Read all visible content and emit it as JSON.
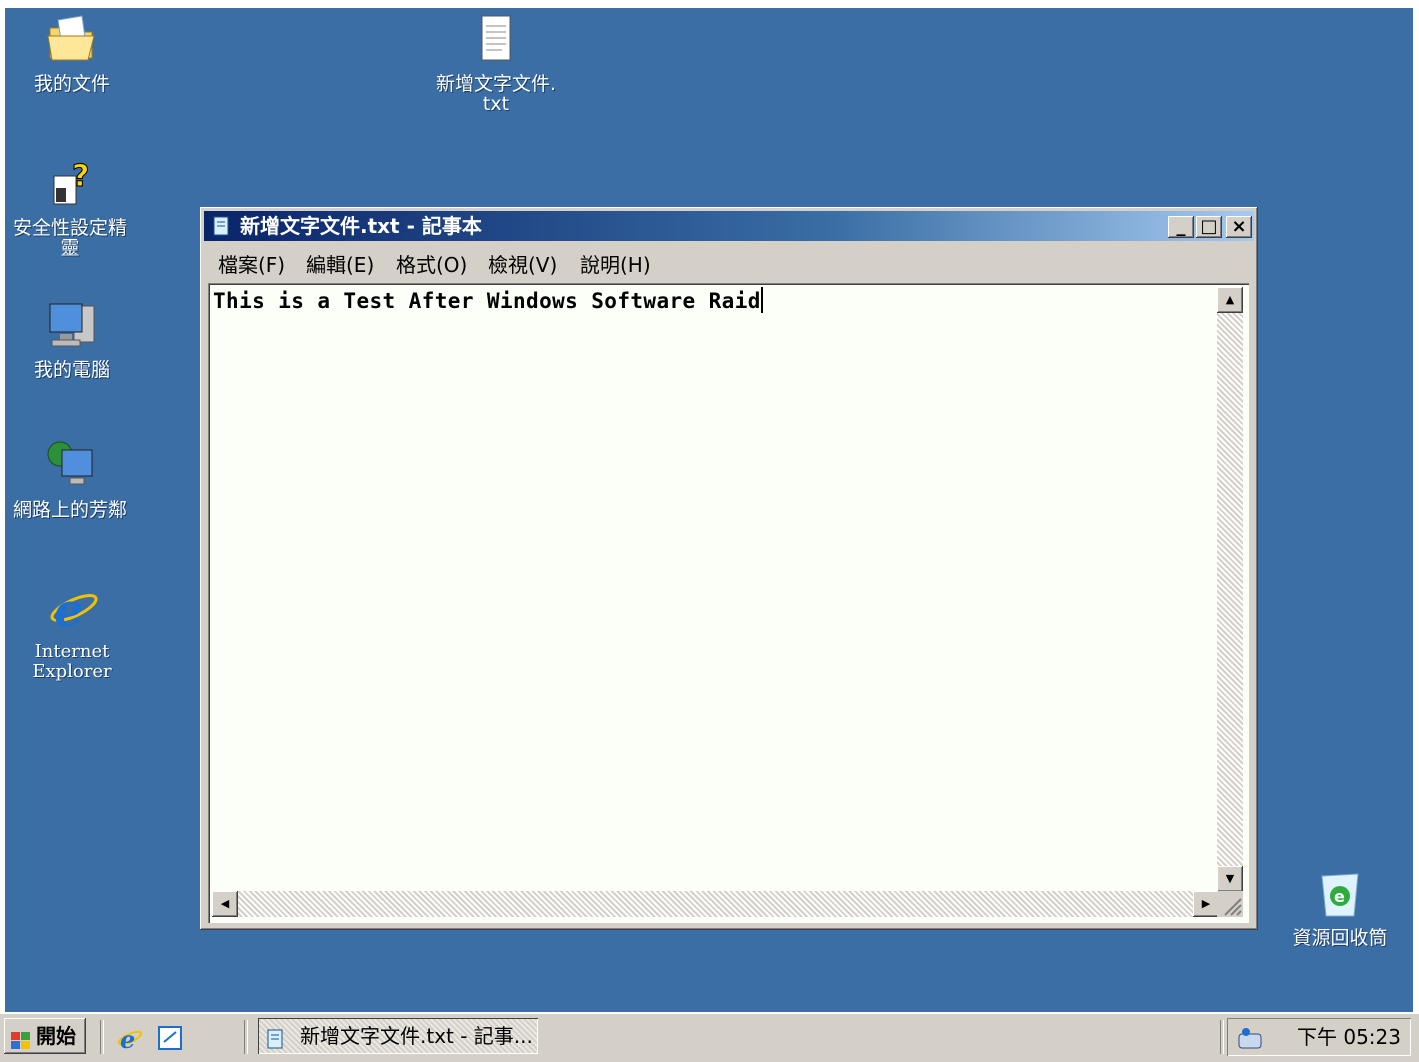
{
  "desktop": {
    "icons": [
      {
        "label": "我的文件"
      },
      {
        "label": "新增文字文件.\ntxt"
      },
      {
        "label": "安全性設定精\n靈"
      },
      {
        "label": "我的電腦"
      },
      {
        "label": "網路上的芳鄰"
      },
      {
        "label": "Internet\nExplorer"
      },
      {
        "label": "資源回收筒"
      }
    ]
  },
  "notepad": {
    "title": "新增文字文件.txt - 記事本",
    "caption_buttons": {
      "minimize": "_",
      "maximize": "□",
      "close": "×"
    },
    "menu": [
      "檔案(F)",
      "編輯(E)",
      "格式(O)",
      "檢視(V)",
      "說明(H)"
    ],
    "content": "This is a Test After Windows Software Raid"
  },
  "taskbar": {
    "start_label": "開始",
    "task_label": "新增文字文件.txt - 記事...",
    "clock": "下午 05:23"
  },
  "colors": {
    "desktop": "#3a6ea5",
    "titlebar_start": "#0a246a",
    "titlebar_end": "#a6caf0",
    "chrome": "#d4d0c8"
  },
  "icons_semantic": [
    "my-documents-icon",
    "text-file-icon",
    "security-wizard-icon",
    "my-computer-icon",
    "network-places-icon",
    "internet-explorer-icon",
    "recycle-bin-icon",
    "notepad-icon",
    "windows-flag-icon",
    "volume-icon"
  ]
}
